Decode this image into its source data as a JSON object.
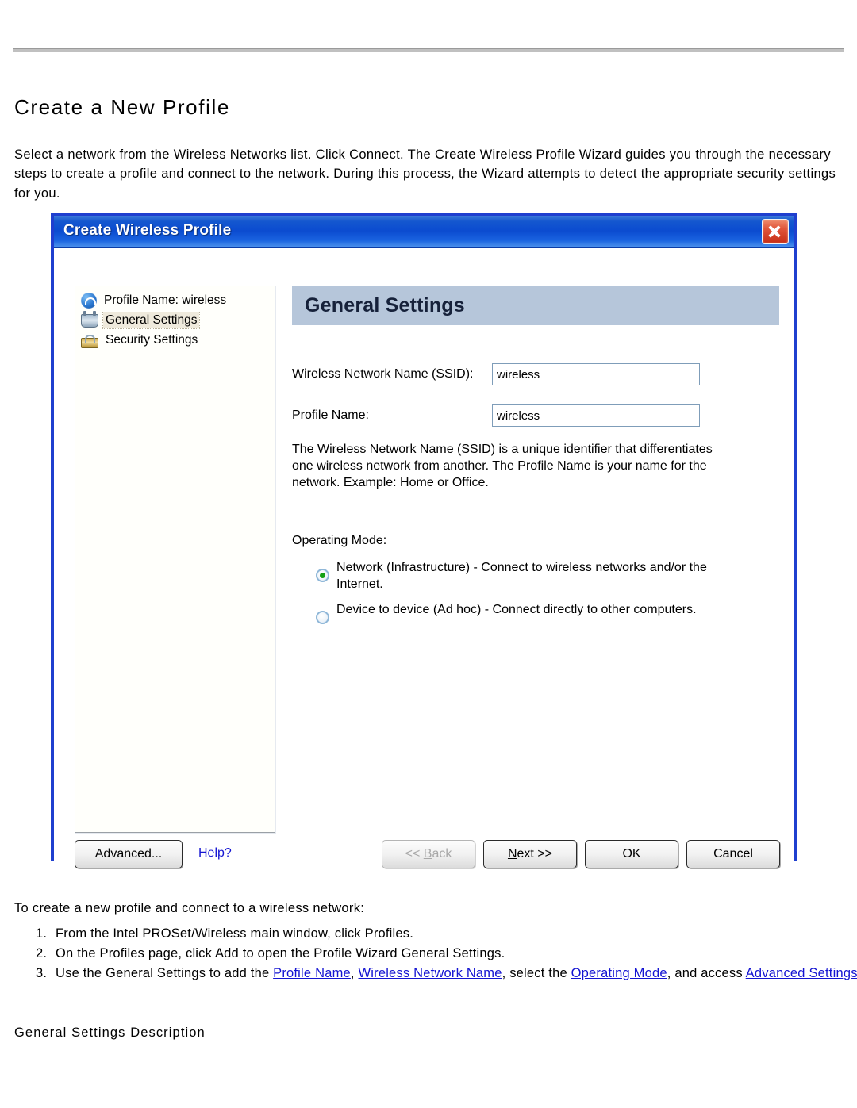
{
  "page": {
    "title": "Create a New Profile",
    "intro": "Select a network from the Wireless Networks list. Click Connect. The Create Wireless Profile Wizard guides you through the necessary steps to create a profile and connect to the network. During this process, the Wizard attempts to detect the appropriate security settings for you.",
    "outro": "To create a new profile and connect to a wireless network:",
    "subheading": "General Settings Description",
    "steps": [
      {
        "parts": [
          {
            "text": "From the Intel PROSet/Wireless main window, click Profiles.",
            "link": false
          }
        ]
      },
      {
        "parts": [
          {
            "text": "On the Profiles page, click Add to open the Profile Wizard General Settings.",
            "link": false
          }
        ]
      },
      {
        "parts": [
          {
            "text": "Use the General Settings to add the ",
            "link": false
          },
          {
            "text": "Profile Name",
            "link": true
          },
          {
            "text": ", ",
            "link": false
          },
          {
            "text": "Wireless Network Name",
            "link": true
          },
          {
            "text": ", select the ",
            "link": false
          },
          {
            "text": "Operating Mode",
            "link": true
          },
          {
            "text": ", and access ",
            "link": false
          },
          {
            "text": "Advanced Settings",
            "link": true
          },
          {
            "text": ".",
            "link": false
          }
        ]
      }
    ]
  },
  "dialog": {
    "title": "Create Wireless Profile",
    "close_icon": "close-icon",
    "tree": [
      {
        "label": "Profile Name: wireless",
        "icon": "wifi-globe-icon",
        "selected": false
      },
      {
        "label": "General Settings",
        "icon": "adapter-icon",
        "selected": true
      },
      {
        "label": "Security Settings",
        "icon": "lock-icon",
        "selected": false
      }
    ],
    "pane": {
      "header": "General Settings",
      "fields": [
        {
          "label": "Wireless Network Name (SSID):",
          "value": "wireless",
          "placeholder": ""
        },
        {
          "label": "Profile Name:",
          "value": "wireless",
          "placeholder": ""
        }
      ],
      "description": "The Wireless Network Name (SSID) is a unique identifier that differentiates one wireless network from another. The Profile Name is your name for the network. Example: Home or Office.",
      "operating_mode_label": "Operating Mode:",
      "operating_modes": [
        {
          "label": "Network (Infrastructure) - Connect to wireless networks and/or the Internet.",
          "checked": true
        },
        {
          "label": "Device to device (Ad hoc) - Connect directly to other computers.",
          "checked": false
        }
      ]
    },
    "buttons": {
      "advanced": "Advanced...",
      "help": "Help?",
      "back": "<< Back",
      "back_underline": "B",
      "next": "Next >>",
      "next_underline": "N",
      "ok": "OK",
      "cancel": "Cancel"
    }
  },
  "colors": {
    "titlebar_blue": "#0b4bd0",
    "dialog_border": "#1f3fcf",
    "pane_header": "#b6c6da",
    "link": "#1414d2",
    "radio_dot_green": "#14a014",
    "close_red": "#c62d16",
    "tree_selection": "#efeadc"
  }
}
